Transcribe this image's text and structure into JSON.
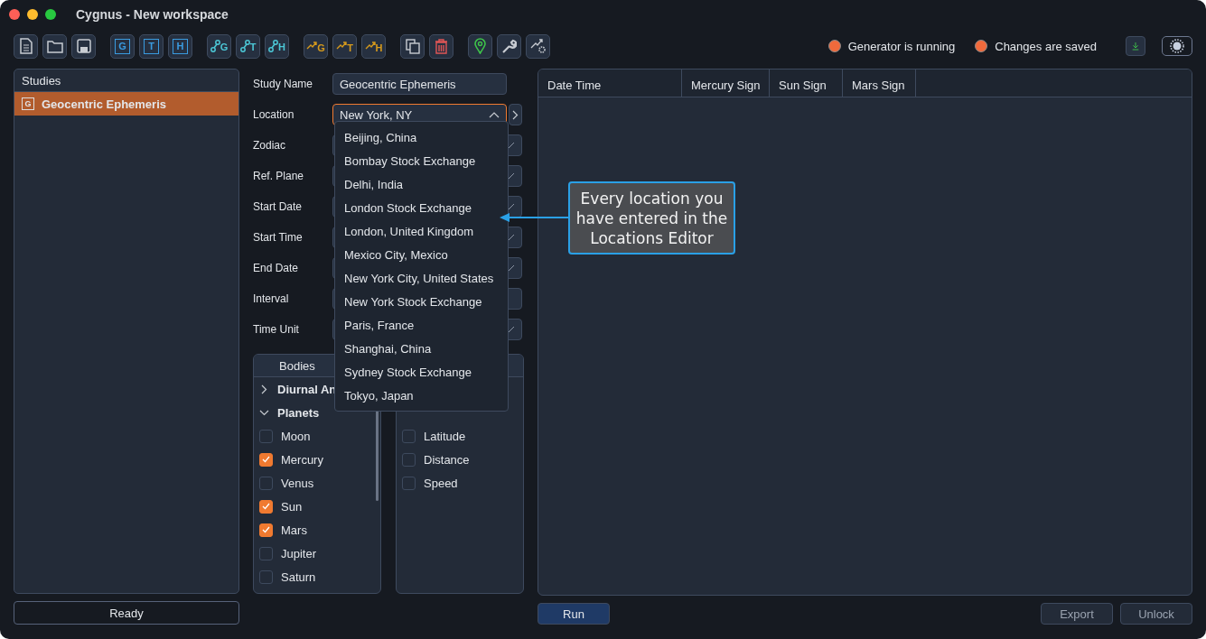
{
  "window": {
    "title": "Cygnus - New workspace"
  },
  "toolbar": [
    {
      "kind": "doc"
    },
    {
      "kind": "folder"
    },
    {
      "kind": "save"
    },
    {
      "kind": "boxed",
      "letter": "G"
    },
    {
      "kind": "boxed",
      "letter": "T"
    },
    {
      "kind": "boxed",
      "letter": "H"
    },
    {
      "kind": "nodes",
      "letter": "G"
    },
    {
      "kind": "nodes",
      "letter": "T"
    },
    {
      "kind": "nodes",
      "letter": "H"
    },
    {
      "kind": "trend",
      "letter": "G"
    },
    {
      "kind": "trend",
      "letter": "T"
    },
    {
      "kind": "trend",
      "letter": "H"
    },
    {
      "kind": "copy"
    },
    {
      "kind": "trash"
    },
    {
      "kind": "pin"
    },
    {
      "kind": "wrench"
    },
    {
      "kind": "trendgear"
    }
  ],
  "status": [
    {
      "label": "Generator is running",
      "color": "#f06a3c"
    },
    {
      "label": "Changes are saved",
      "color": "#f06a3c"
    }
  ],
  "sidebar": {
    "title": "Studies",
    "items": [
      {
        "icon": "G",
        "label": "Geocentric Ephemeris",
        "selected": true
      }
    ],
    "status": "Ready"
  },
  "form": {
    "fields": [
      {
        "label": "Study Name",
        "value": "Geocentric Ephemeris",
        "kind": "text"
      },
      {
        "label": "Location",
        "value": "New York, NY",
        "kind": "open"
      },
      {
        "label": "Zodiac",
        "kind": "select"
      },
      {
        "label": "Ref. Plane",
        "kind": "select"
      },
      {
        "label": "Start Date",
        "kind": "select"
      },
      {
        "label": "Start Time",
        "kind": "select"
      },
      {
        "label": "End Date",
        "kind": "select"
      },
      {
        "label": "Interval",
        "kind": "plain"
      },
      {
        "label": "Time Unit",
        "kind": "select"
      }
    ],
    "dropdown": [
      "Beijing, China",
      "Bombay Stock Exchange",
      "Delhi, India",
      "London Stock Exchange",
      "London, United Kingdom",
      "Mexico City, Mexico",
      "New York City, United States",
      "New York Stock Exchange",
      "Paris, France",
      "Shanghai, China",
      "Sydney Stock Exchange",
      "Tokyo, Japan"
    ]
  },
  "bodies": {
    "title": "Bodies",
    "items": [
      {
        "kind": "group",
        "label": "Diurnal An",
        "expanded": false
      },
      {
        "kind": "group",
        "label": "Planets",
        "expanded": true
      },
      {
        "kind": "item",
        "label": "Moon",
        "checked": false
      },
      {
        "kind": "item",
        "label": "Mercury",
        "checked": true
      },
      {
        "kind": "item",
        "label": "Venus",
        "checked": false
      },
      {
        "kind": "item",
        "label": "Sun",
        "checked": true
      },
      {
        "kind": "item",
        "label": "Mars",
        "checked": true
      },
      {
        "kind": "item",
        "label": "Jupiter",
        "checked": false
      },
      {
        "kind": "item",
        "label": "Saturn",
        "checked": false
      }
    ]
  },
  "properties": [
    {
      "label": "Latitude",
      "checked": false
    },
    {
      "label": "Distance",
      "checked": false
    },
    {
      "label": "Speed",
      "checked": false
    }
  ],
  "callout": "Every location you have entered in the Locations Editor",
  "table": {
    "columns": [
      "Date Time",
      "Mercury Sign",
      "Sun Sign",
      "Mars Sign"
    ]
  },
  "buttons": {
    "run": "Run",
    "export": "Export",
    "unlock": "Unlock"
  }
}
